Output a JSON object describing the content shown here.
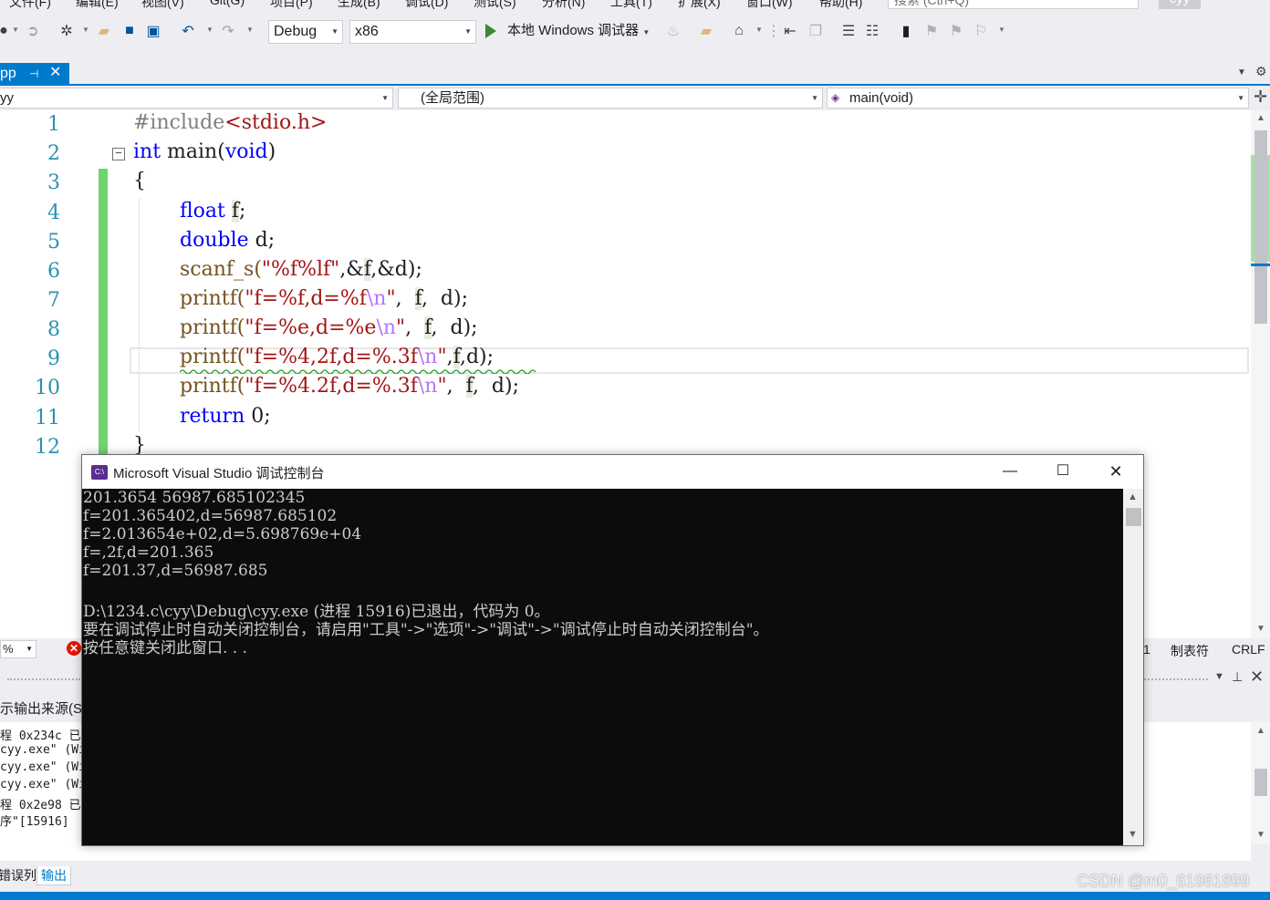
{
  "menu": {
    "items": [
      "文件(F)",
      "编辑(E)",
      "视图(V)",
      "Git(G)",
      "项目(P)",
      "生成(B)",
      "调试(D)",
      "测试(S)",
      "分析(N)",
      "工具(T)",
      "扩展(X)",
      "窗口(W)",
      "帮助(H)"
    ],
    "search_placeholder": "搜索 (Ctrl+Q)",
    "user": "cyy"
  },
  "toolbar": {
    "config": "Debug",
    "platform": "x86",
    "run_label": "本地 Windows 调试器"
  },
  "document_tab": {
    "label": "pp",
    "pin": "⊣",
    "close": "✕"
  },
  "navbar": {
    "project": "yy",
    "scope": "(全局范围)",
    "member": "main(void)"
  },
  "editor": {
    "line_numbers": [
      "1",
      "2",
      "3",
      "4",
      "5",
      "6",
      "7",
      "8",
      "9",
      "10",
      "11",
      "12"
    ],
    "lines": {
      "l1_pp": "#include",
      "l1_inc": "<stdio.h>",
      "l2_kw1": "int",
      "l2_fn": " main(",
      "l2_kw2": "void",
      "l2_end": ")",
      "l3": "{",
      "l4_kw": "float",
      "l4_var": "f",
      "l4_end": ";",
      "l5_kw": "double",
      "l5_rest": " d;",
      "l6_fn": "scanf_s(",
      "l6_str": "\"%f%lf\"",
      "l6_mid": ",&",
      "l6_f": "f",
      "l6_end": ",&d);",
      "l7_fn": "printf(",
      "l7_str": "\"f=%f,d=%f",
      "l7_esc": "\\n",
      "l7_q": "\"",
      "l7_sep": ",  ",
      "l7_f": "f",
      "l7_end": ",  d);",
      "l8_fn": "printf(",
      "l8_str": "\"f=%e,d=%e",
      "l8_esc": "\\n",
      "l8_q": "\"",
      "l8_sep": ",  ",
      "l8_f": "f",
      "l8_end": ",  d);",
      "l9_fn": "printf(",
      "l9_str": "\"f=%4,2f,d=%.3f",
      "l9_esc": "\\n",
      "l9_q": "\"",
      "l9_sep": ",",
      "l9_f": "f",
      "l9_end": ",d);",
      "l10_fn": "printf(",
      "l10_str": "\"f=%4.2f,d=%.3f",
      "l10_esc": "\\n",
      "l10_q": "\"",
      "l10_sep": ",  ",
      "l10_f": "f",
      "l10_end": ",  d);",
      "l11_kw": "return",
      "l11_rest": " 0;",
      "l12": "}"
    }
  },
  "status": {
    "zoom": "%",
    "col": "1",
    "tabs": "制表符",
    "eol": "CRLF"
  },
  "output_panel": {
    "source_label": "示输出来源(S):",
    "lines": [
      "程 0x234c 已",
      "cyy.exe\" (Wi",
      "cyy.exe\" (Wi",
      "cyy.exe\" (Wi",
      "程 0x2e98 已",
      "序\"[15916]"
    ],
    "tabs": [
      "错误列表",
      "输出"
    ]
  },
  "console": {
    "title": "Microsoft Visual Studio 调试控制台",
    "icon_text": "C:\\",
    "lines": [
      "201.3654 56987.685102345",
      "f=201.365402,d=56987.685102",
      "f=2.013654e+02,d=5.698769e+04",
      "f=,2f,d=201.365",
      "f=201.37,d=56987.685",
      "",
      "D:\\1234.c\\cyy\\Debug\\cyy.exe (进程 15916)已退出，代码为 0。",
      "要在调试停止时自动关闭控制台，请启用\"工具\"->\"选项\"->\"调试\"->\"调试停止时自动关闭控制台\"。",
      "按任意键关闭此窗口. . ."
    ]
  },
  "watermark": "CSDN @m0_61961899",
  "colors": {
    "accent": "#007acc",
    "keyword": "#0000ff",
    "string": "#a31515",
    "escape": "#b776fb",
    "change_bar": "#6ed56e",
    "console_bg": "#0c0c0c"
  },
  "icons": [
    "back-icon",
    "forward-icon",
    "new-project-icon",
    "open-folder-icon",
    "save-icon",
    "save-all-icon",
    "undo-icon",
    "redo-icon",
    "run-icon",
    "fire-icon",
    "find-in-files-icon",
    "bookmark-icon",
    "comment-icon",
    "uncomment-icon",
    "pin-icon",
    "close-icon",
    "gear-icon",
    "error-icon",
    "minimize-icon",
    "maximize-icon"
  ]
}
